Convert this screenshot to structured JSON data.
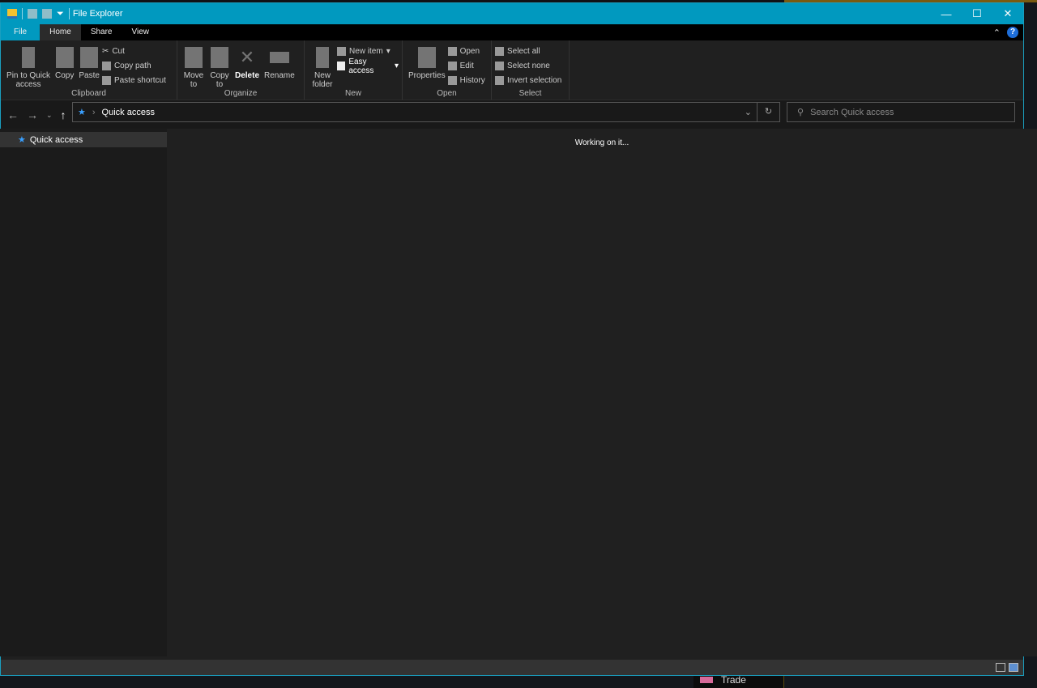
{
  "window": {
    "title": "File Explorer"
  },
  "tabs": [
    {
      "label": "File"
    },
    {
      "label": "Home"
    },
    {
      "label": "Share"
    },
    {
      "label": "View"
    }
  ],
  "ribbon": {
    "clipboard": {
      "label": "Clipboard",
      "pin": "Pin to Quick access",
      "copy": "Copy",
      "paste": "Paste",
      "cut": "Cut",
      "copy_path": "Copy path",
      "paste_shortcut": "Paste shortcut"
    },
    "organize": {
      "label": "Organize",
      "move_to": "Move to",
      "copy_to": "Copy to",
      "delete": "Delete",
      "rename": "Rename"
    },
    "new": {
      "label": "New",
      "new_folder": "New folder",
      "new_item": "New item",
      "easy_access": "Easy access"
    },
    "open": {
      "label": "Open",
      "properties": "Properties",
      "open": "Open",
      "edit": "Edit",
      "history": "History"
    },
    "select": {
      "label": "Select",
      "select_all": "Select all",
      "select_none": "Select none",
      "invert": "Invert selection"
    }
  },
  "address": {
    "path": "Quick access",
    "search_placeholder": "Search Quick access"
  },
  "sidebar": {
    "items": [
      {
        "label": "Quick access"
      }
    ]
  },
  "content": {
    "status": "Working on it..."
  },
  "background": {
    "taskbar_item": "Trade"
  },
  "colors": {
    "accent": "#0199bf",
    "star": "#3aa0ff"
  }
}
